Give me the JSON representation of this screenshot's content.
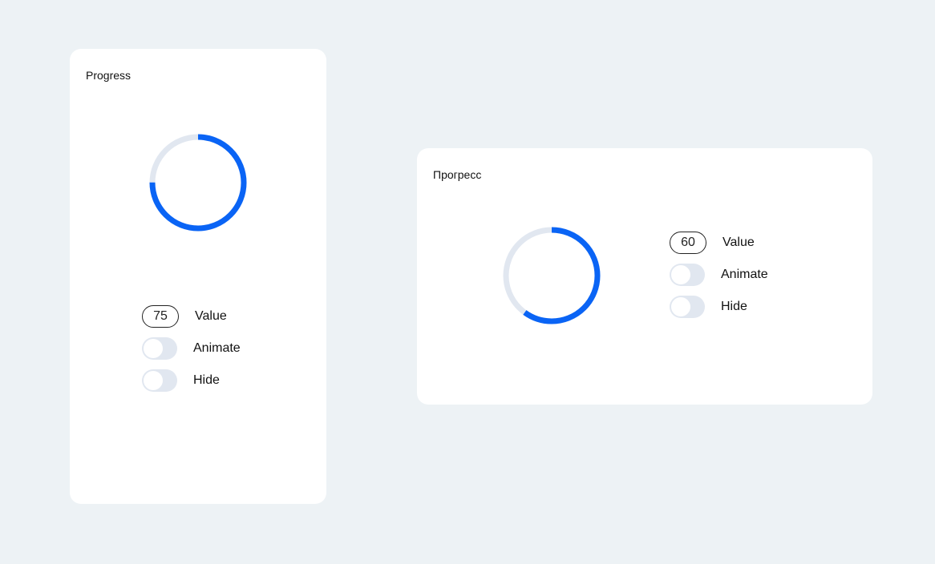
{
  "panels": [
    {
      "title": "Progress",
      "progress_value": 75,
      "value_label": "Value",
      "animate_label": "Animate",
      "animate_on": false,
      "hide_label": "Hide",
      "hide_on": false
    },
    {
      "title": "Прогресс",
      "progress_value": 60,
      "value_label": "Value",
      "animate_label": "Animate",
      "animate_on": false,
      "hide_label": "Hide",
      "hide_on": false
    }
  ],
  "colors": {
    "background": "#edf2f5",
    "panel": "#ffffff",
    "accent": "#0a64f5",
    "track": "#e1e7f0"
  }
}
